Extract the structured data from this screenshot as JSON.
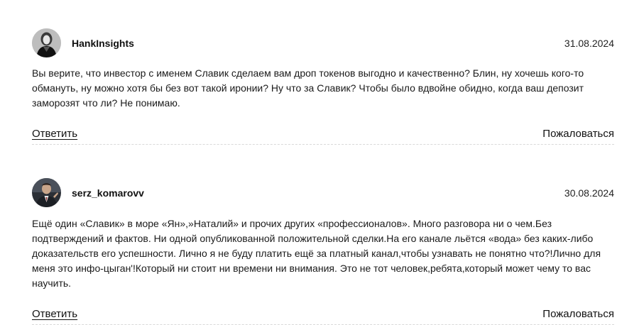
{
  "comments": [
    {
      "author": "HankInsights",
      "date": "31.08.2024",
      "text": "Вы верите, что инвестор с именем Славик сделаем вам дроп токенов выгодно и качественно? Блин, ну хочешь кого-то обмануть, ну можно хотя бы без вот такой иронии? Ну что за Славик? Чтобы было вдвойне обидно, когда ваш депозит заморозят что ли? Не понимаю.",
      "reply_label": "Ответить",
      "report_label": "Пожаловаться",
      "avatar_icon": "user-avatar-photo"
    },
    {
      "author": "serz_komarovv",
      "date": "30.08.2024",
      "text": "Ещё один «Славик» в море «Ян»,»Наталий» и прочих других «профессионалов». Много разговора ни о чем.Без подтверждений и фактов. Ни одной опубликованной положительной сделки.На его канале льётся «вода» без каких-либо доказательств его успешности. Лично я не буду платить ещё за платный канал,чтобы узнавать не понятно что?!Лично для меня это инфо-цыган'!Который ни стоит ни времени ни внимания. Это не тот человек,ребята,который может чему то вас научить.",
      "reply_label": "Ответить",
      "report_label": "Пожаловаться",
      "avatar_icon": "user-avatar-photo"
    }
  ]
}
